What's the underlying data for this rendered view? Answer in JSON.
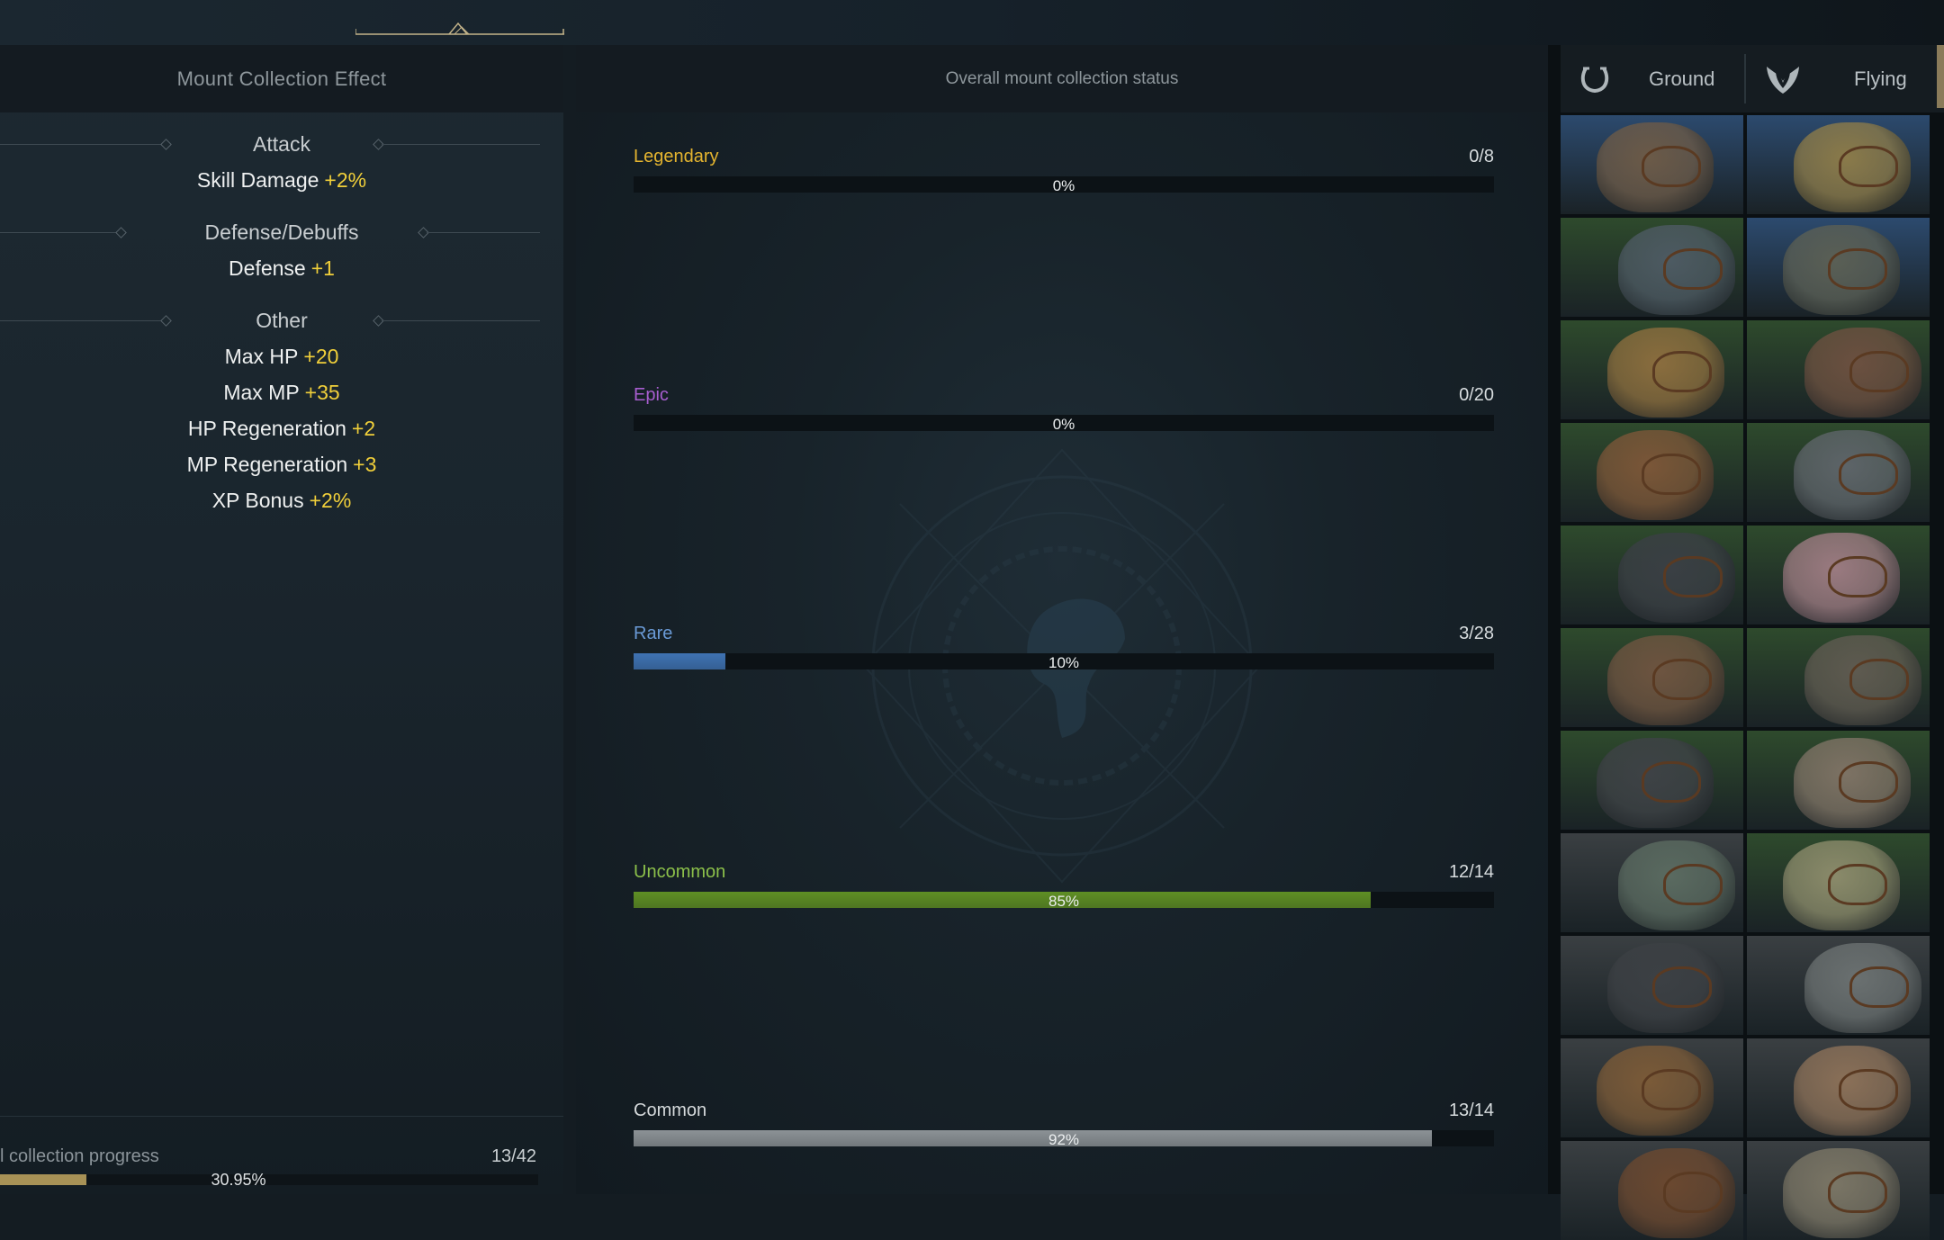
{
  "effect_panel": {
    "title": "Mount Collection Effect",
    "sections": [
      {
        "title": "Attack",
        "effects": [
          {
            "name": "Skill Damage",
            "value": "+2%"
          }
        ]
      },
      {
        "title": "Defense/Debuffs",
        "effects": [
          {
            "name": "Defense",
            "value": "+1"
          }
        ]
      },
      {
        "title": "Other",
        "effects": [
          {
            "name": "Max HP",
            "value": "+20"
          },
          {
            "name": "Max MP",
            "value": "+35"
          },
          {
            "name": "HP Regeneration",
            "value": "+2"
          },
          {
            "name": "MP Regeneration",
            "value": "+3"
          },
          {
            "name": "XP Bonus",
            "value": "+2%"
          }
        ]
      }
    ],
    "progress": {
      "label": "l collection progress",
      "count": "13/42",
      "percent_text": "30.95%",
      "fraction": 0.3095
    }
  },
  "status_panel": {
    "title": "Overall mount collection status",
    "rarities": [
      {
        "name": "Legendary",
        "count": "0/8",
        "percent_text": "0%",
        "fraction": 0.0,
        "color": "#e4b42f",
        "bar_color": "#b08a2a"
      },
      {
        "name": "Epic",
        "count": "0/20",
        "percent_text": "0%",
        "fraction": 0.0,
        "color": "#a85ed0",
        "bar_color": "#7a46a0"
      },
      {
        "name": "Rare",
        "count": "3/28",
        "percent_text": "10%",
        "fraction": 0.107,
        "color": "#6a9ad6",
        "bar_color": "#3f73b3"
      },
      {
        "name": "Uncommon",
        "count": "12/14",
        "percent_text": "85%",
        "fraction": 0.857,
        "color": "#8cc04a",
        "bar_color": "#5f8f24"
      },
      {
        "name": "Common",
        "count": "13/14",
        "percent_text": "92%",
        "fraction": 0.928,
        "color": "#d5d9db",
        "bar_color": "#8c9296"
      }
    ]
  },
  "mount_panel": {
    "tabs": [
      {
        "label": "Ground",
        "icon": "horseshoe-icon"
      },
      {
        "label": "Flying",
        "icon": "wing-icon"
      }
    ],
    "mounts": [
      {
        "name": "ground-mount-1",
        "bg": "#2c4a6e",
        "tone": "#6b5a48"
      },
      {
        "name": "flying-mount-1",
        "bg": "#2c4a6e",
        "tone": "#8a7a4a"
      },
      {
        "name": "ground-mount-2",
        "bg": "#2e4a2c",
        "tone": "#4d5a62"
      },
      {
        "name": "flying-mount-2",
        "bg": "#2c4a6e",
        "tone": "#5a5f55"
      },
      {
        "name": "ground-mount-3",
        "bg": "#2e4a2c",
        "tone": "#8a6d3e"
      },
      {
        "name": "flying-mount-3",
        "bg": "#2e4a2c",
        "tone": "#6b5040"
      },
      {
        "name": "ground-mount-4",
        "bg": "#2e4a2c",
        "tone": "#7a5638"
      },
      {
        "name": "flying-mount-4",
        "bg": "#2e4a2c",
        "tone": "#5d6468"
      },
      {
        "name": "ground-mount-5",
        "bg": "#2e4a2c",
        "tone": "#3a3f44"
      },
      {
        "name": "flying-mount-5",
        "bg": "#2e4a2c",
        "tone": "#9a7a80"
      },
      {
        "name": "ground-mount-6",
        "bg": "#2e4a2c",
        "tone": "#6d5440"
      },
      {
        "name": "flying-mount-6",
        "bg": "#2e4a2c",
        "tone": "#5e5a50"
      },
      {
        "name": "ground-mount-7",
        "bg": "#2e4a2c",
        "tone": "#3e4246"
      },
      {
        "name": "flying-mount-7",
        "bg": "#2e4a2c",
        "tone": "#7d7264"
      },
      {
        "name": "ground-mount-8",
        "bg": "#3a3f42",
        "tone": "#5a6a60"
      },
      {
        "name": "flying-mount-8",
        "bg": "#2e4a2c",
        "tone": "#8a8a6a"
      },
      {
        "name": "ground-mount-9",
        "bg": "#3a3f42",
        "tone": "#3c4044"
      },
      {
        "name": "flying-mount-9",
        "bg": "#3a3f42",
        "tone": "#6a7070"
      },
      {
        "name": "ground-mount-10",
        "bg": "#3a3f42",
        "tone": "#7a5a38"
      },
      {
        "name": "flying-mount-10",
        "bg": "#3a3f42",
        "tone": "#8a7058"
      },
      {
        "name": "ground-mount-11",
        "bg": "#3a3f42",
        "tone": "#6a4830"
      },
      {
        "name": "flying-mount-11",
        "bg": "#3a3f42",
        "tone": "#7a7565"
      }
    ]
  }
}
